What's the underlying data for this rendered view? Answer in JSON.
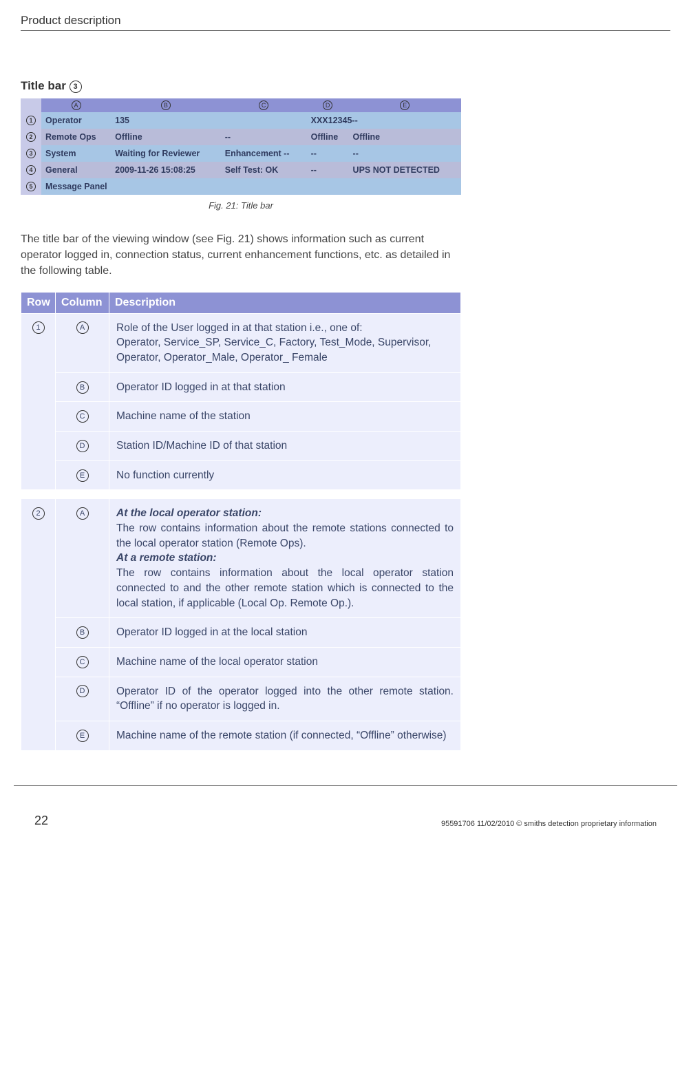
{
  "header": {
    "section": "Product description"
  },
  "section": {
    "title_prefix": "Title bar ",
    "title_num": "3"
  },
  "tbar": {
    "cols": {
      "A": "A",
      "B": "B",
      "C": "C",
      "D": "D",
      "E": "E"
    },
    "rows": [
      {
        "n": "1",
        "A": "Operator",
        "B": "135",
        "C": "",
        "D": "XXX12345",
        "DE": "--",
        "E": ""
      },
      {
        "n": "2",
        "A": "Remote Ops",
        "B": "Offline",
        "C": "--",
        "D": "Offline",
        "E": "Offline"
      },
      {
        "n": "3",
        "A": "System",
        "B": "Waiting for Reviewer",
        "C": "Enhancement --",
        "D": "--",
        "E": "--"
      },
      {
        "n": "4",
        "A": "General",
        "B": "2009-11-26 15:08:25",
        "C": "Self Test: OK",
        "D": "--",
        "E": "UPS NOT DETECTED"
      },
      {
        "n": "5",
        "A": "Message Panel",
        "B": "",
        "C": "",
        "D": "",
        "E": ""
      }
    ]
  },
  "caption": "Fig. 21: Title bar",
  "paragraph": "The title bar of the viewing window (see Fig. 21) shows information such as current operator logged in, connection status, current enhancement functions, etc. as detailed in the following table.",
  "table2": {
    "head": {
      "row": "Row",
      "col": "Column",
      "desc": "Description"
    },
    "g1": {
      "row": "1",
      "A": {
        "col": "A",
        "text": "Role of the User logged in at that station i.e., one of:\nOperator, Service_SP, Service_C, Factory, Test_Mode, Supervisor, Operator, Operator_Male, Operator_ Female"
      },
      "B": {
        "col": "B",
        "text": "Operator ID logged in at that station"
      },
      "C": {
        "col": "C",
        "text": "Machine name of the station"
      },
      "D": {
        "col": "D",
        "text": "Station ID/Machine ID of that station"
      },
      "E": {
        "col": "E",
        "text": "No function currently"
      }
    },
    "g2": {
      "row": "2",
      "A": {
        "col": "A",
        "h1": "At the local operator station:",
        "t1": "The row contains information about the remote stations connected to the local operator station (Remote Ops).",
        "h2": "At a remote station:",
        "t2": "The row contains information about the local operator station connected to and the other remote station which is connected to the local station, if applicable (Local Op. Remote Op.)."
      },
      "B": {
        "col": "B",
        "text": "Operator ID logged in at the local station"
      },
      "C": {
        "col": "C",
        "text": "Machine name of the local operator station"
      },
      "D": {
        "col": "D",
        "text": "Operator ID of the operator logged into the other remote station. “Offline” if no operator is logged in."
      },
      "E": {
        "col": "E",
        "text": "Machine name of the remote station (if connected, “Offline” otherwise)"
      }
    }
  },
  "footer": {
    "page": "22",
    "copy": "95591706 11/02/2010 © smiths detection proprietary information"
  }
}
